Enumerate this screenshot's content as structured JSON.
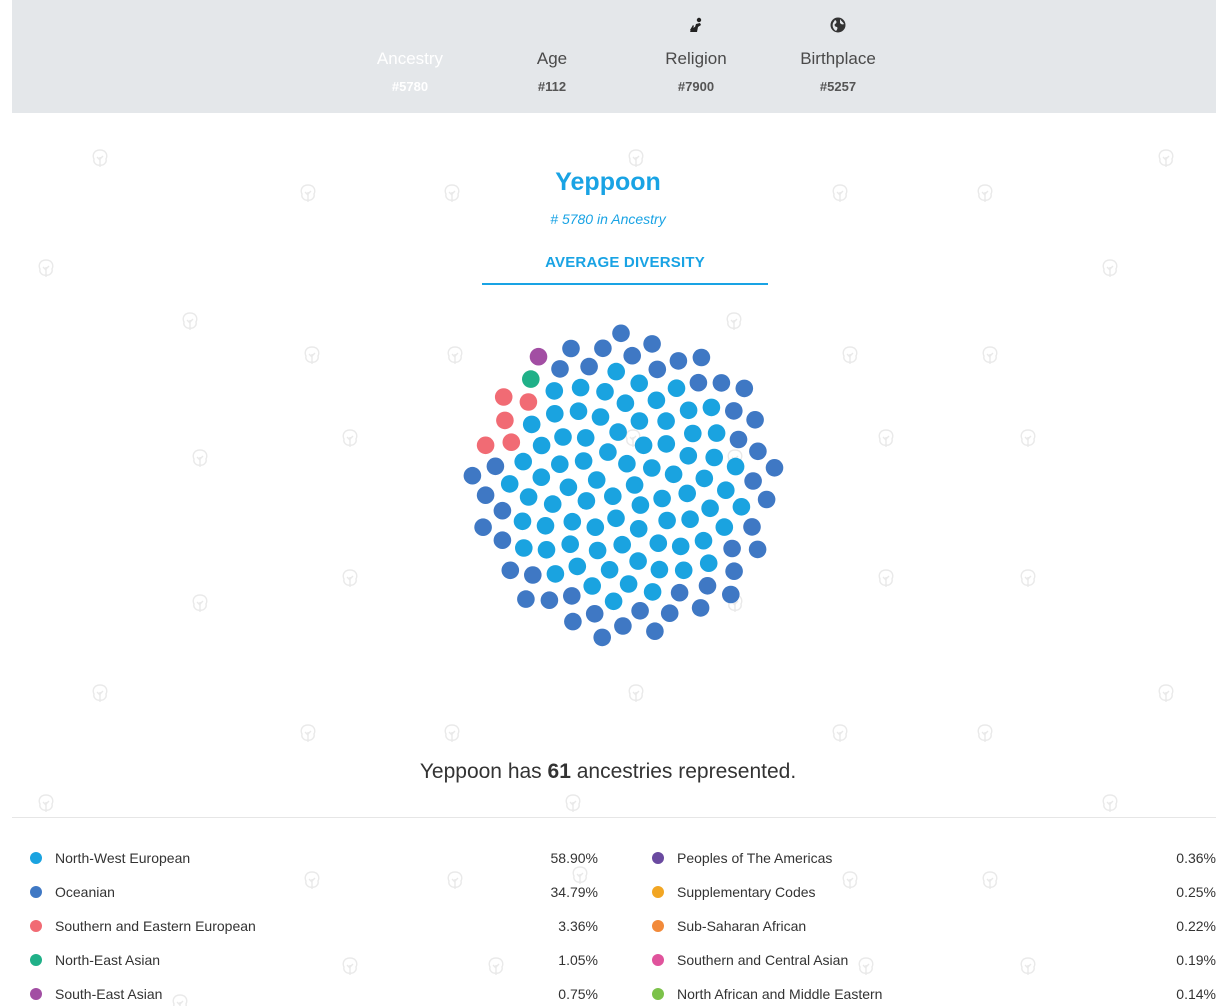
{
  "tabs": [
    {
      "label": "Ancestry",
      "rank": "#5780",
      "icon": "family-tree-icon",
      "active": true
    },
    {
      "label": "Age",
      "rank": "#112",
      "icon": "",
      "active": false
    },
    {
      "label": "Religion",
      "rank": "#7900",
      "icon": "praying-person-icon",
      "active": false
    },
    {
      "label": "Birthplace",
      "rank": "#5257",
      "icon": "globe-icon",
      "active": false
    }
  ],
  "header": {
    "title": "Yeppoon",
    "subtitle": "# 5780 in Ancestry",
    "diversity_label": "AVERAGE DIVERSITY"
  },
  "summary": {
    "prefix": "Yeppoon has ",
    "count": "61",
    "suffix": " ancestries represented."
  },
  "colors": {
    "accent": "#19a3e4",
    "north_west_european": "#1aa3e0",
    "oceanian": "#3f78c4",
    "southern_eastern_european": "#f16b74",
    "north_east_asian": "#20b088",
    "south_east_asian": "#a24ea3"
  },
  "dot_grid": {
    "total": 131,
    "counts": {
      "North-West European": 77,
      "Oceanian": 46,
      "Southern and Eastern European": 5,
      "North-East Asian": 1,
      "South-East Asian": 1
    }
  },
  "legend_left": [
    {
      "name": "North-West European",
      "pct": "58.90%",
      "color": "#1aa3e0"
    },
    {
      "name": "Oceanian",
      "pct": "34.79%",
      "color": "#3f78c4"
    },
    {
      "name": "Southern and Eastern European",
      "pct": "3.36%",
      "color": "#f16b74"
    },
    {
      "name": "North-East Asian",
      "pct": "1.05%",
      "color": "#20b088"
    },
    {
      "name": "South-East Asian",
      "pct": "0.75%",
      "color": "#a24ea3"
    }
  ],
  "legend_right": [
    {
      "name": "Peoples of The Americas",
      "pct": "0.36%",
      "color": "#6a4aa0"
    },
    {
      "name": "Supplementary Codes",
      "pct": "0.25%",
      "color": "#f2a623"
    },
    {
      "name": "Sub-Saharan African",
      "pct": "0.22%",
      "color": "#f28a3a"
    },
    {
      "name": "Southern and Central Asian",
      "pct": "0.19%",
      "color": "#e0539c"
    },
    {
      "name": "North African and Middle Eastern",
      "pct": "0.14%",
      "color": "#7cc24a"
    }
  ]
}
